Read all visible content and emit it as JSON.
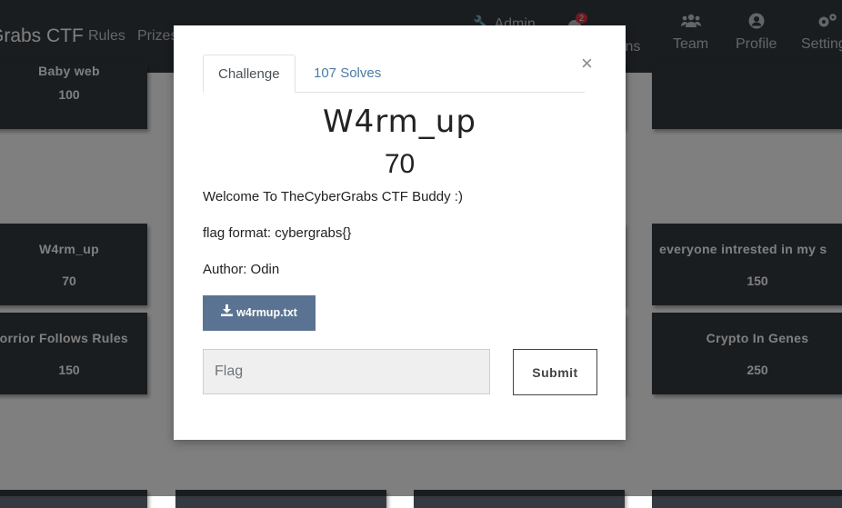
{
  "navbar": {
    "brand": "Grabs CTF",
    "links": [
      "Rules",
      "Prizes"
    ],
    "admin": "Admin",
    "notification_count": "2",
    "notifications_label": "ions",
    "team": "Team",
    "profile": "Profile",
    "settings": "Settings"
  },
  "board": {
    "cards": [
      {
        "name": "Baby web",
        "value": "100"
      },
      {
        "name": "W4rm_up",
        "value": "70"
      },
      {
        "name": "everyone intrested in my s",
        "value": "150"
      },
      {
        "name": "Xorrior Follows Rules",
        "value": "150"
      },
      {
        "name": "Crypto In Genes",
        "value": "250"
      }
    ]
  },
  "modal": {
    "tabs": {
      "challenge": "Challenge",
      "solves": "107 Solves"
    },
    "close": "×",
    "name": "W4rm_up",
    "value": "70",
    "description": [
      "Welcome To TheCyberGrabs CTF Buddy :)",
      "flag format: cybergrabs{}",
      "Author: Odin"
    ],
    "file": "w4rmup.txt",
    "flag_placeholder": "Flag",
    "submit": "Submit"
  },
  "colors": {
    "navbar": "#343a40",
    "card": "#343a40",
    "file_button": "#5b7392",
    "tab_link": "#4a7ba7",
    "badge": "#dc3545"
  }
}
